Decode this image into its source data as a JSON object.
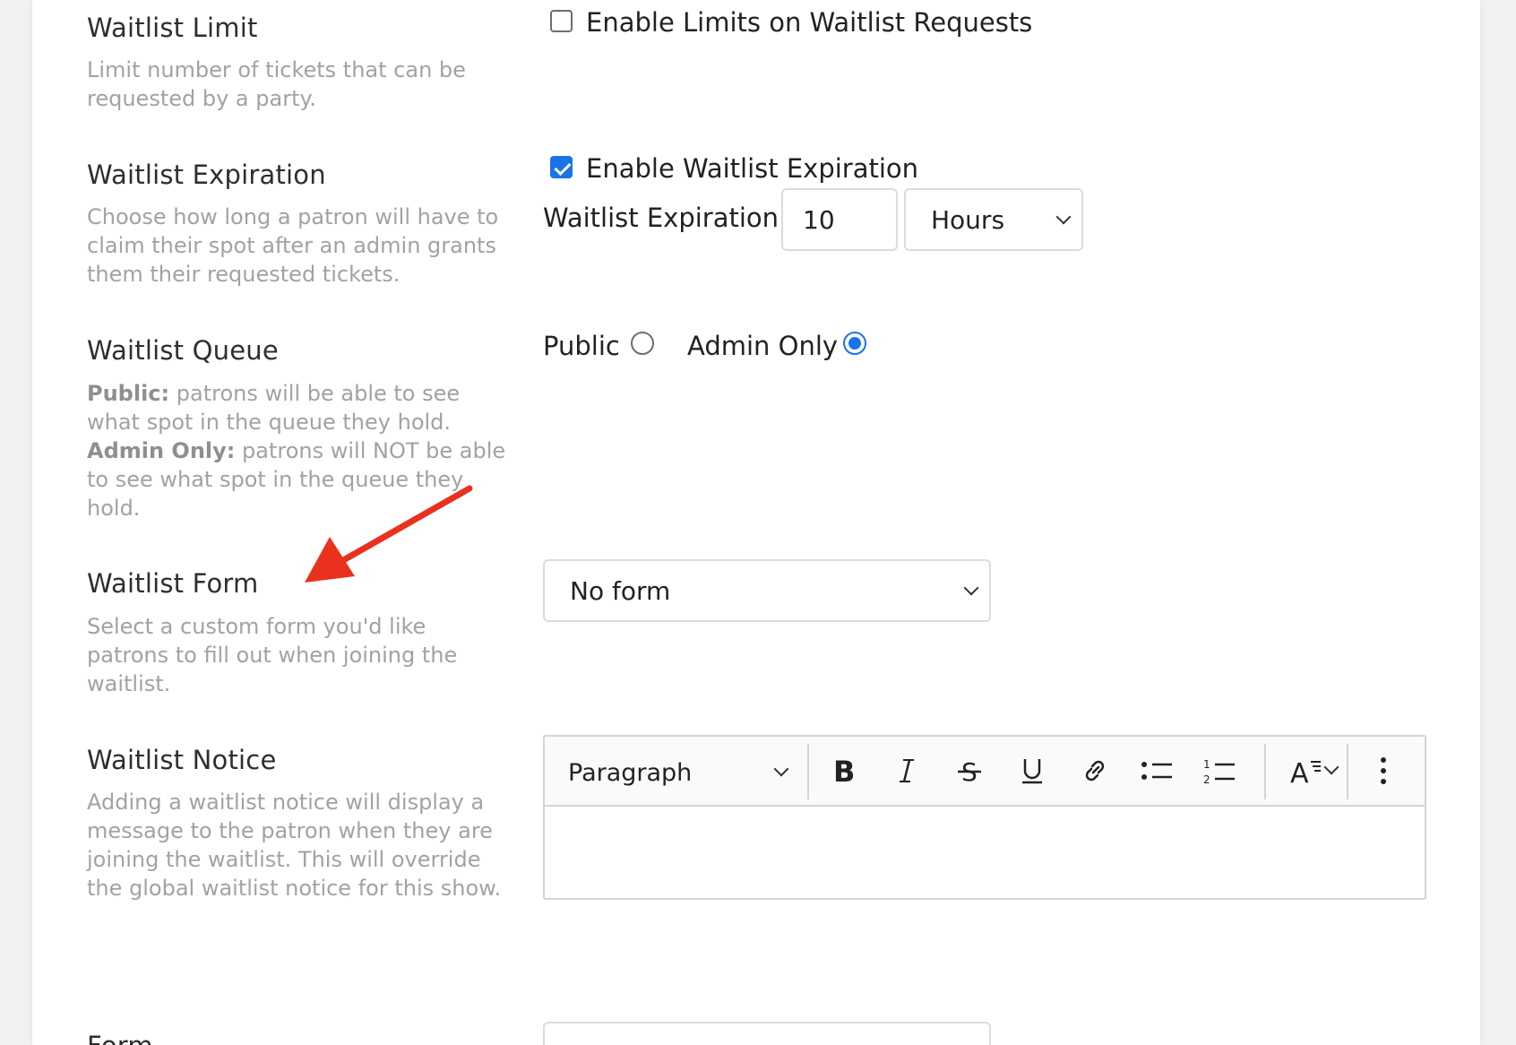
{
  "settings": {
    "limit": {
      "heading": "Waitlist Limit",
      "desc": "Limit number of tickets that can be requested by a party.",
      "checkbox_label": "Enable Limits on Waitlist Requests",
      "checked": false
    },
    "expiration": {
      "heading": "Waitlist Expiration",
      "desc": "Choose how long a patron will have to claim their spot after an admin grants them their requested tickets.",
      "checkbox_label": "Enable Waitlist Expiration",
      "checked": true,
      "field_label": "Waitlist Expiration:",
      "value": "10",
      "unit": "Hours"
    },
    "queue": {
      "heading": "Waitlist Queue",
      "public_term": "Public:",
      "public_desc": " patrons will be able to see what spot in the queue they hold.",
      "admin_term": "Admin Only:",
      "admin_desc": " patrons will NOT be able to see what spot in the queue they hold.",
      "option_public": "Public",
      "option_admin": "Admin Only",
      "selected": "Admin Only"
    },
    "form": {
      "heading": "Waitlist Form",
      "desc": "Select a custom form you'd like patrons to fill out when joining the waitlist.",
      "selected": "No form"
    },
    "notice": {
      "heading": "Waitlist Notice",
      "desc": "Adding a waitlist notice will display a message to the patron when they are joining the waitlist. This will override the global waitlist notice for this show.",
      "block_style": "Paragraph",
      "toolbar_icons": [
        "bold-icon",
        "italic-icon",
        "strikethrough-icon",
        "underline-icon",
        "link-icon",
        "bullet-list-icon",
        "numbered-list-icon",
        "text-style-icon",
        "more-options-icon"
      ],
      "content": ""
    },
    "next": {
      "heading": "Form"
    }
  },
  "annotation": {
    "color": "#e8321e",
    "target": "Waitlist Form"
  },
  "colors": {
    "accent": "#1a73e8",
    "muted_text": "#a2a2a2"
  }
}
